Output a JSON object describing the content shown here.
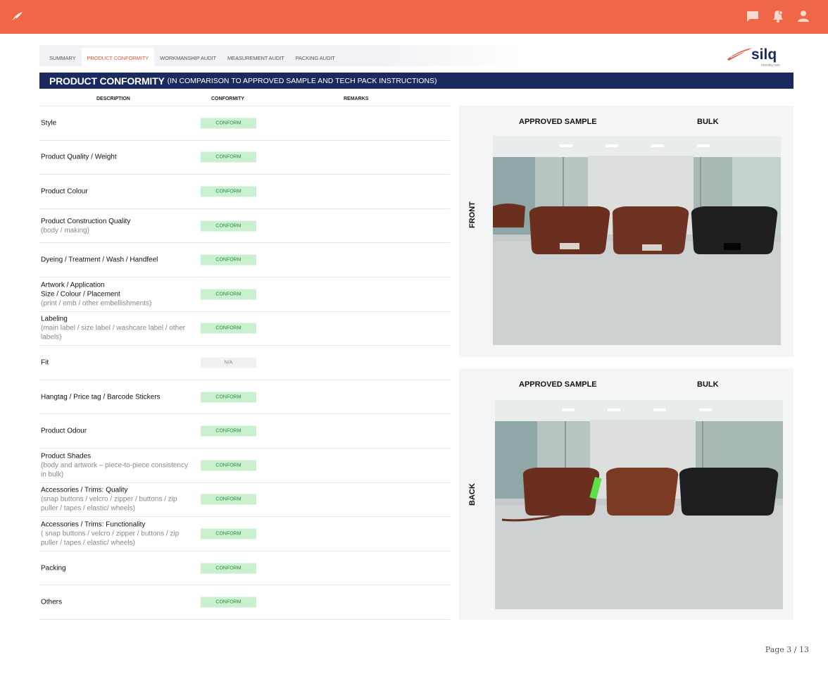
{
  "header": {
    "logo_icon": "feather-icon",
    "icons": [
      "chat-icon",
      "bell-icon",
      "user-icon"
    ],
    "accent": "#ef6747"
  },
  "tabs": [
    {
      "label": "SUMMARY",
      "active": false
    },
    {
      "label": "PRODUCT CONFORMITY",
      "active": true
    },
    {
      "label": "WORKMANSHIP AUDIT",
      "active": false
    },
    {
      "label": "MEASUREMENT AUDIT",
      "active": false
    },
    {
      "label": "PACKING AUDIT",
      "active": false
    }
  ],
  "brand": {
    "name": "silq",
    "site": "onesilq.com"
  },
  "section": {
    "title": "PRODUCT CONFORMITY",
    "subtitle": "(IN COMPARISON TO APPROVED SAMPLE AND TECH PACK INSTRUCTIONS)",
    "color": "#1b2a5e"
  },
  "columns": {
    "description": "DESCRIPTION",
    "conformity": "CONFORMITY",
    "remarks": "REMARKS"
  },
  "items": [
    {
      "title": "Style",
      "sub": "",
      "status": "CONFORM"
    },
    {
      "title": "Product Quality / Weight",
      "sub": "",
      "status": "CONFORM"
    },
    {
      "title": "Product Colour",
      "sub": "",
      "status": "CONFORM"
    },
    {
      "title": "Product Construction Quality",
      "sub": "(body / making)",
      "status": "CONFORM"
    },
    {
      "title": "Dyeing / Treatment / Wash / Handfeel",
      "sub": "",
      "status": "CONFORM"
    },
    {
      "title": "Artwork / Application\nSize / Colour / Placement",
      "sub": "(print / emb / other embellishments)",
      "status": "CONFORM"
    },
    {
      "title": "Labeling",
      "sub": "(main label / size label / washcare label / other labels)",
      "status": "CONFORM"
    },
    {
      "title": "Fit",
      "sub": "",
      "status": "N/A"
    },
    {
      "title": "Hangtag / Price tag /  Barcode Stickers",
      "sub": "",
      "status": "CONFORM"
    },
    {
      "title": "Product Odour",
      "sub": "",
      "status": "CONFORM"
    },
    {
      "title": "Product Shades",
      "sub": "(body and artwork – piece-to-piece consistency in bulk)",
      "status": "CONFORM"
    },
    {
      "title": "Accessories / Trims: Quality",
      "sub": "(snap buttons / velcro / zipper / buttons / zip puller / tapes / elastic/ wheels)",
      "status": "CONFORM"
    },
    {
      "title": "Accessories / Trims: Functionality",
      "sub": "( snap buttons / velcro / zipper / buttons / zip puller / tapes / elastic/ wheels)",
      "status": "CONFORM"
    },
    {
      "title": "Packing",
      "sub": "",
      "status": "CONFORM"
    },
    {
      "title": "Others",
      "sub": "",
      "status": "CONFORM"
    }
  ],
  "panels": [
    {
      "left_label": "APPROVED SAMPLE",
      "right_label": "BULK",
      "side_label": "FRONT"
    },
    {
      "left_label": "APPROVED SAMPLE",
      "right_label": "BULK",
      "side_label": "BACK"
    }
  ],
  "footer": {
    "page": "Page 3 / 13"
  }
}
